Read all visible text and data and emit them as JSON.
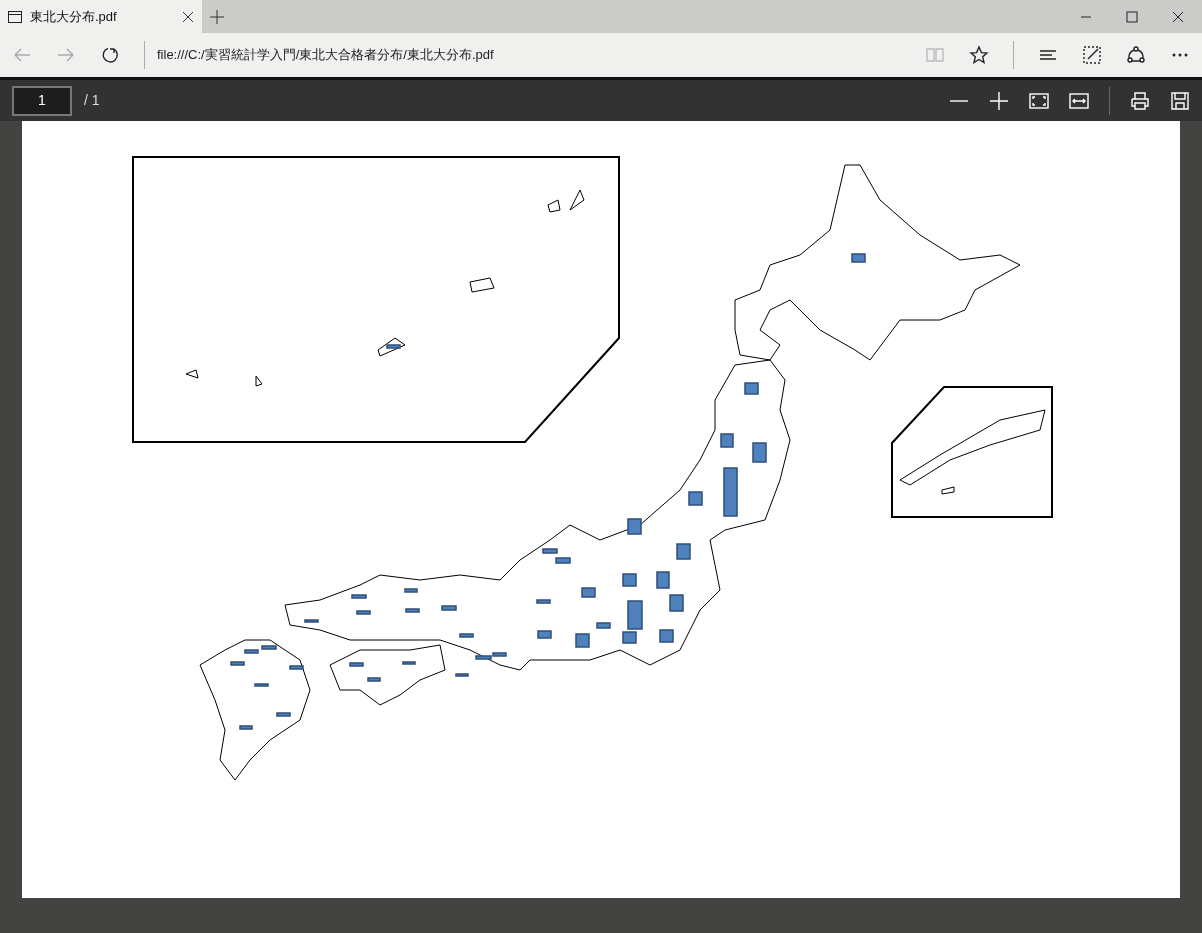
{
  "tab": {
    "title": "東北大分布.pdf"
  },
  "address_bar": {
    "url": "file:///C:/実習統計学入門/東北大合格者分布/東北大分布.pdf"
  },
  "toolbar": {
    "reading_view_disabled": true
  },
  "pdf_toolbar": {
    "page_number": "1",
    "page_total": "/ 1"
  }
}
